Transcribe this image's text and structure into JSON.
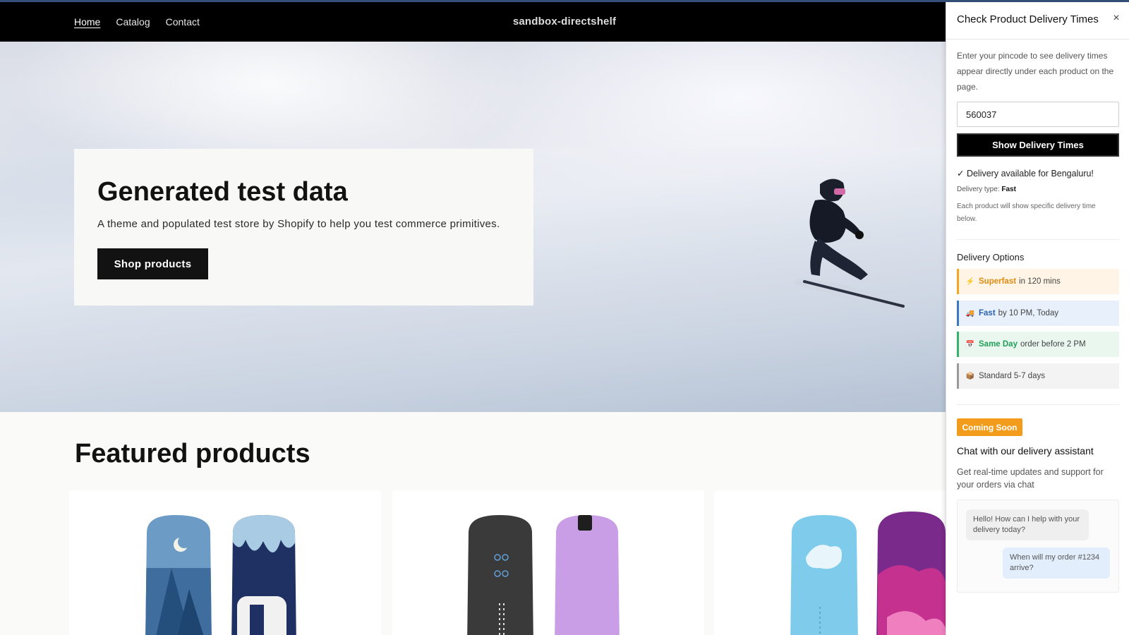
{
  "store": {
    "nav": [
      "Home",
      "Catalog",
      "Contact"
    ],
    "brand": "sandbox-directshelf",
    "hero": {
      "title": "Generated test data",
      "subtitle": "A theme and populated test store by Shopify to help you test commerce primitives.",
      "button": "Shop products"
    },
    "featured_title": "Featured products"
  },
  "panel": {
    "title": "Check Product Delivery Times",
    "close": "×",
    "intro": "Enter your pincode to see delivery times appear directly under each product on the page.",
    "pincode_value": "560037",
    "show_button": "Show Delivery Times",
    "availability": "✓ Delivery available for Bengaluru!",
    "type_label": "Delivery type:",
    "type_value": "Fast",
    "each_note": "Each product will show specific delivery time below.",
    "options_heading": "Delivery Options",
    "options": [
      {
        "icon": "⚡",
        "icon_name": "lightning-icon",
        "name": "Superfast",
        "detail": "in 120 mins",
        "color": "#f5a623"
      },
      {
        "icon": "🚚",
        "icon_name": "truck-icon",
        "name": "Fast",
        "detail": "by 10 PM, Today",
        "color": "#3a78c4"
      },
      {
        "icon": "📅",
        "icon_name": "calendar-icon",
        "name": "Same Day",
        "detail": "order before 2 PM",
        "color": "#35b36a"
      },
      {
        "icon": "📦",
        "icon_name": "package-icon",
        "name": "",
        "detail": "Standard 5-7 days",
        "color": "#9a9a9a"
      }
    ],
    "coming_soon": "Coming Soon",
    "chat_heading": "Chat with our delivery assistant",
    "chat_sub": "Get real-time updates and support for your orders via chat",
    "chat": [
      {
        "from": "assistant",
        "text": "Hello! How can I help with your delivery today?"
      },
      {
        "from": "user",
        "text": "When will my order #1234 arrive?"
      }
    ]
  },
  "colors": {
    "accent_orange": "#f39c1c",
    "superfast": "#f5a623",
    "fast": "#3a78c4",
    "same_day": "#35b36a",
    "standard": "#9a9a9a"
  }
}
